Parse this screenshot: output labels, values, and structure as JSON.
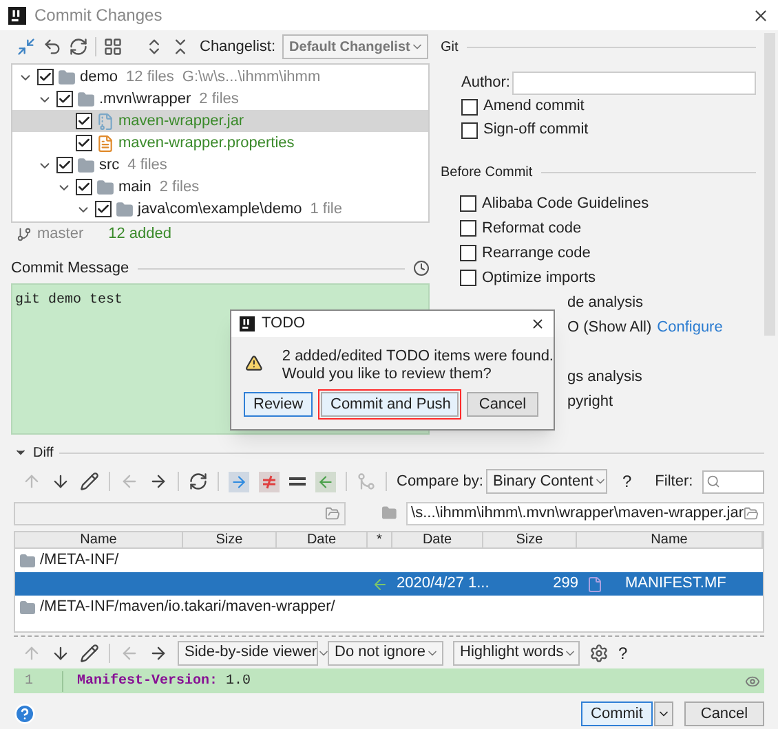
{
  "window": {
    "title": "Commit Changes"
  },
  "changes": {
    "changelist_label": "Changelist:",
    "changelist": "Default Changelist",
    "tree": [
      {
        "kind": "folder",
        "name": "demo",
        "info": "12 files",
        "path": "G:\\w\\s...\\ihmm\\ihmm",
        "checked": true,
        "expanded": true,
        "selected": false,
        "children": [
          {
            "kind": "folder",
            "name": ".mvn\\wrapper",
            "info": "2 files",
            "checked": true,
            "expanded": true,
            "selected": false,
            "children": [
              {
                "kind": "jar",
                "name": "maven-wrapper.jar",
                "checked": true,
                "selected": true
              },
              {
                "kind": "properties",
                "name": "maven-wrapper.properties",
                "checked": true,
                "selected": false
              }
            ]
          },
          {
            "kind": "folder",
            "name": "src",
            "info": "4 files",
            "checked": true,
            "expanded": true,
            "selected": false,
            "children": [
              {
                "kind": "folder",
                "name": "main",
                "info": "2 files",
                "checked": true,
                "expanded": true,
                "selected": false,
                "children": [
                  {
                    "kind": "folder",
                    "name": "java\\com\\example\\demo",
                    "info": "1 file",
                    "checked": true,
                    "expanded": true,
                    "selected": false
                  }
                ]
              }
            ]
          }
        ]
      }
    ],
    "branch": "master",
    "status": "12 added"
  },
  "commit_message": {
    "label": "Commit Message",
    "value": "git demo test"
  },
  "git": {
    "title": "Git",
    "author_label": "Author:",
    "options": [
      {
        "label": "Amend commit",
        "checked": false
      },
      {
        "label": "Sign-off commit",
        "checked": false
      }
    ]
  },
  "before_commit": {
    "title": "Before Commit",
    "options": [
      {
        "kind": "checkbox",
        "label": "Alibaba Code Guidelines",
        "checked": false
      },
      {
        "kind": "checkbox",
        "label": "Reformat code",
        "checked": false
      },
      {
        "kind": "checkbox",
        "label": "Rearrange code",
        "checked": false
      },
      {
        "kind": "checkbox",
        "label": "Optimize imports",
        "checked": false
      },
      {
        "kind": "covered",
        "label": "de analysis"
      },
      {
        "kind": "covered",
        "label": "O (Show All)",
        "link": "Configure"
      },
      {
        "kind": "hidden"
      },
      {
        "kind": "covered",
        "label": "gs analysis"
      },
      {
        "kind": "covered",
        "label": "pyright"
      }
    ]
  },
  "dialog": {
    "title": "TODO",
    "message_lines": [
      "2 added/edited TODO items were found.",
      "Would you like to review them?"
    ],
    "buttons": [
      {
        "label": "Review",
        "default": true,
        "highlighted": false
      },
      {
        "label": "Commit and Push",
        "default": false,
        "highlighted": true
      },
      {
        "label": "Cancel",
        "default": false,
        "highlighted": false
      }
    ]
  },
  "diff": {
    "title": "Diff",
    "expanded": true,
    "compare_label": "Compare by:",
    "compare": "Binary Content",
    "help": "?",
    "filter_label": "Filter:",
    "right_path": "\\s...\\ihmm\\ihmm\\.mvn\\wrapper\\maven-wrapper.jar",
    "columns": [
      "Name",
      "Size",
      "Date",
      "*",
      "Date",
      "Size",
      "Name"
    ],
    "rows": [
      {
        "kind": "folder",
        "name": "/META-INF/",
        "selected": false
      },
      {
        "kind": "file",
        "date": "2020/4/27 1...",
        "size": "299",
        "name": "MANIFEST.MF",
        "selected": true
      },
      {
        "kind": "folder",
        "name": "/META-INF/maven/io.takari/maven-wrapper/",
        "selected": false
      }
    ]
  },
  "viewer": {
    "mode": "Side-by-side viewer",
    "ignore": "Do not ignore",
    "highlight": "Highlight words",
    "help": "?",
    "lines": [
      {
        "number": "1",
        "key": "Manifest-Version:",
        "value": " 1.0"
      }
    ]
  },
  "footer": {
    "buttons": [
      {
        "kind": "split",
        "label": "Commit"
      },
      {
        "kind": "plain",
        "label": "Cancel"
      }
    ]
  }
}
